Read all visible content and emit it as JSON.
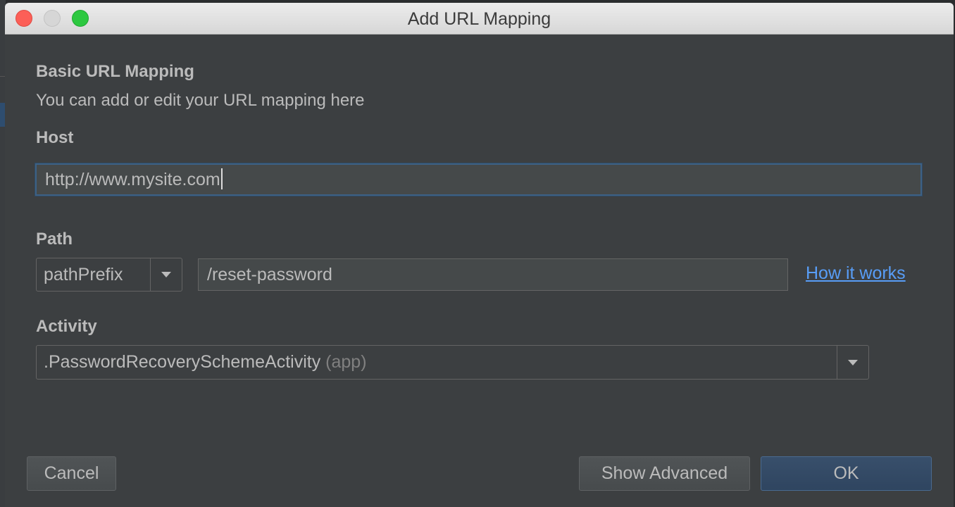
{
  "window": {
    "title": "Add URL Mapping"
  },
  "section": {
    "heading": "Basic URL Mapping",
    "description": "You can add or edit your URL mapping here"
  },
  "host": {
    "label": "Host",
    "value": "http://www.mysite.com"
  },
  "path": {
    "label": "Path",
    "type_selected": "pathPrefix",
    "value": "/reset-password",
    "help_link": "How it works"
  },
  "activity": {
    "label": "Activity",
    "selected": ".PasswordRecoverySchemeActivity",
    "module_hint": "(app)"
  },
  "buttons": {
    "cancel": "Cancel",
    "show_advanced": "Show Advanced",
    "ok": "OK"
  },
  "colors": {
    "link": "#589df6",
    "focus_border": "#3d6185",
    "primary_button": "#2f4560",
    "dialog_bg": "#3c3f41"
  }
}
